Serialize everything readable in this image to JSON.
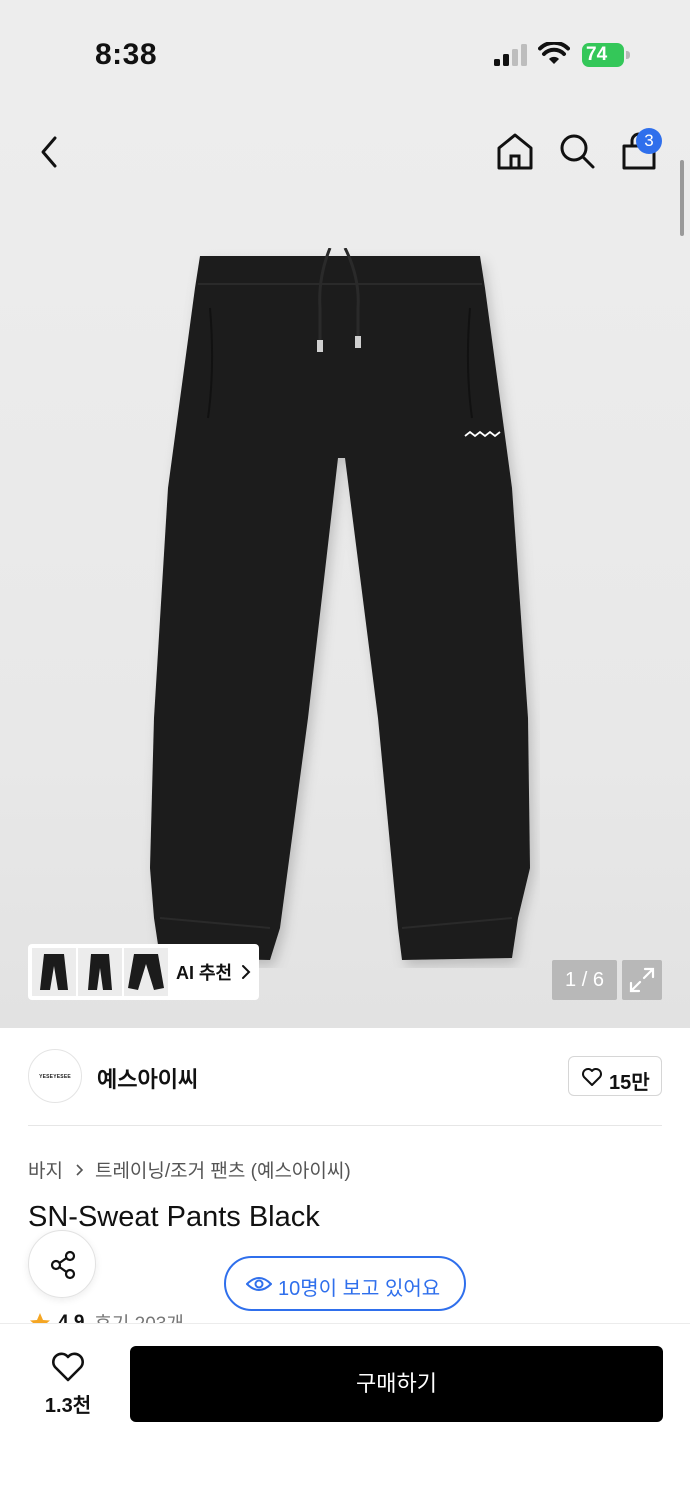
{
  "status_bar": {
    "time": "8:38",
    "battery": "74"
  },
  "header": {
    "cart_count": "3"
  },
  "gallery": {
    "ai_label": "AI 추천",
    "page_counter": "1 / 6"
  },
  "brand": {
    "logo_text": "YESEYESEE",
    "name": "예스아이씨",
    "likes": "15만"
  },
  "product": {
    "breadcrumb_category": "바지",
    "breadcrumb_sub": "트레이닝/조거 팬츠 (예스아이씨)",
    "title": "SN-Sweat Pants Black",
    "viewers": "10명이 보고 있어요",
    "rating": "4.9",
    "reviews": "후기 203개"
  },
  "bottom_bar": {
    "wish_count": "1.3천",
    "buy_label": "구매하기"
  },
  "colors": {
    "accent": "#2f6fec",
    "battery": "#34c759",
    "star": "#f5a623",
    "buy_button": "#000000"
  }
}
